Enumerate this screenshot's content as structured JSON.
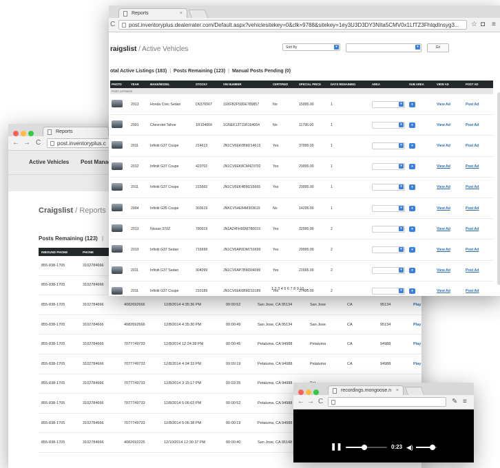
{
  "colors": {
    "accent": "#2a6db0",
    "header_dark": "#23282b",
    "select_blue": "#3b7fe0"
  },
  "reports_window": {
    "tab_title": "Reports",
    "url": "post.inventoryplus.c",
    "nav": [
      "Active Vehicles",
      "Post Manag"
    ],
    "breadcrumb": {
      "site": "Craigslist",
      "sep": "/",
      "page": "Reports"
    },
    "panel_title": "Posts Remaining (123)",
    "panel_sep": "|",
    "columns": [
      "INBOUND PHONE",
      "PHONE",
      "",
      "",
      "",
      "",
      "",
      "",
      ""
    ],
    "rows": [
      [
        "855-838-1705",
        "3102784666",
        "",
        "",
        "",
        "",
        "",
        "",
        ""
      ],
      [
        "855-838-1705",
        "3102784666",
        "",
        "",
        "",
        "",
        "",
        "",
        ""
      ],
      [
        "855-838-1705",
        "3102784666",
        "4082692666",
        "12/8/2014 4:35:36 PM",
        "00:00:52",
        "San Jose, CA 95134",
        "San Jose",
        "CA",
        "95134",
        "Play"
      ],
      [
        "855-838-1705",
        "3102784666",
        "4082692666",
        "12/8/2014 4:35:30 PM",
        "00:00:49",
        "San Jose, CA 95134",
        "San Jose",
        "CA",
        "95134",
        "Play"
      ],
      [
        "855-838-1705",
        "3102784666",
        "7077749733",
        "12/8/2014 12:24:38 PM",
        "00:00:45",
        "Petaluma, CA 94988",
        "Petaluma",
        "CA",
        "94988",
        "Play"
      ],
      [
        "855-838-1705",
        "3102784666",
        "7077749733",
        "12/8/2014 4:34:33 PM",
        "00:00:19",
        "Petaluma, CA 94988",
        "Petaluma",
        "CA",
        "94988",
        "Play"
      ],
      [
        "855-838-1705",
        "3102784666",
        "7077749733",
        "12/8/2014 3:15:17 PM",
        "00:03:35",
        "Petaluma, CA 94988",
        "Pet",
        "",
        "",
        ""
      ],
      [
        "855-838-1705",
        "3102784666",
        "7077749733",
        "12/8/2014 5:06:03 PM",
        "00:00:52",
        "Petaluma, CA 94988",
        "Pet",
        "",
        "",
        ""
      ],
      [
        "855-838-1705",
        "3102784666",
        "7077749733",
        "12/8/2014 5:06:38 PM",
        "00:00:19",
        "Petaluma, CA 94988",
        "Pet",
        "",
        "",
        ""
      ],
      [
        "855-838-1705",
        "3102784666",
        "4082692225",
        "12/10/2014 12:30:37 PM",
        "00:00:40",
        "San Jose, CA 95148",
        "San",
        "",
        "",
        ""
      ]
    ]
  },
  "vehicles_window": {
    "tab_title": "Reports",
    "url": "post.inventoryplus.dealerrater.com/Default.aspx?vehiclesitekey=0&clk=9788&sitekey=1ey3U3D3DY3NIta5CMV0x1LfTZ3FhtqdInsyg3...",
    "breadcrumb": {
      "site": "raigslist",
      "sep": "/",
      "page": "Active Vehicles"
    },
    "sort_label": "Sort By",
    "go_label": "Go",
    "summary": {
      "active": "otal Active Listings (183)",
      "remaining": "Posts Remaining (123)",
      "pending": "Manual Posts Pending (0)",
      "sep": "|"
    },
    "columns": [
      "PHOTO",
      "YEAR",
      "MAKE/MODEL",
      "STOCK#",
      "VIN NUMBER",
      "CERTIFIED",
      "SPECIAL PRICE",
      "DAYS REMAINING",
      "AREA",
      "SUB AREA",
      "VIEW AD",
      "POST AD"
    ],
    "group_label": "POST LISTINGS",
    "rows": [
      {
        "year": "2013",
        "model": "Honda Civic Sedan",
        "stock": "D6376567",
        "vin": "19XFB2F59DE789857",
        "cert": "No",
        "price": "15995.00",
        "days": "1",
        "view": "View Ad",
        "post": "Post Ad",
        "underline": false
      },
      {
        "year": "2001",
        "model": "Chevrolet Tahoe",
        "stock": "1R104664",
        "vin": "1GNEK13T11R164664",
        "cert": "No",
        "price": "11795.00",
        "days": "1",
        "view": "View Ad",
        "post": "Post Ad",
        "underline": false
      },
      {
        "year": "2011",
        "model": "Infiniti G37 Coupe",
        "stock": "214613",
        "vin": "JN1CV6EK0BM214613",
        "cert": "Yes",
        "price": "37995.00",
        "days": "1",
        "view": "View Ad",
        "post": "Post Ad",
        "underline": false
      },
      {
        "year": "2012",
        "model": "Infiniti G37 Coupe",
        "stock": "423702",
        "vin": "JN1CV6EK8CM423702",
        "cert": "Yes",
        "price": "29995.00",
        "days": "1",
        "view": "View Ad",
        "post": "Post Ad",
        "underline": true
      },
      {
        "year": "2011",
        "model": "Infiniti G37 Coupe",
        "stock": "215665",
        "vin": "JN1CV6EK4BM215665",
        "cert": "Yes",
        "price": "29995.00",
        "days": "1",
        "view": "View Ad",
        "post": "Post Ad",
        "underline": true
      },
      {
        "year": "2004",
        "model": "Infiniti G35 Coupe",
        "stock": "303619",
        "vin": "JNKCV54E84M303619",
        "cert": "No",
        "price": "14295.00",
        "days": "1",
        "view": "View Ad",
        "post": "Post Ad",
        "underline": true
      },
      {
        "year": "2013",
        "model": "Nissan 370Z",
        "stock": "780019",
        "vin": "JN1AZ4FH9DM780019",
        "cert": "Yes",
        "price": "32995.00",
        "days": "2",
        "view": "View Ad",
        "post": "Post Ad",
        "underline": true
      },
      {
        "year": "2013",
        "model": "Infiniti G37 Sedan",
        "stock": "716699",
        "vin": "JN1CV6AP0DM716699",
        "cert": "Yes",
        "price": "29995.00",
        "days": "2",
        "view": "View Ad",
        "post": "Post Ad",
        "underline": true
      },
      {
        "year": "2011",
        "model": "Infiniti G37 Sedan",
        "stock": "304099",
        "vin": "JN1CV6AP7BM304099",
        "cert": "Yes",
        "price": "22995.00",
        "days": "2",
        "view": "View Ad",
        "post": "Post Ad",
        "underline": true
      },
      {
        "year": "2011",
        "model": "Infiniti G37 Coupe",
        "stock": "210189",
        "vin": "JN1CV6EK6BM210189",
        "cert": "Yes",
        "price": "27495.00",
        "days": "2",
        "view": "View Ad",
        "post": "Post Ad",
        "underline": true
      }
    ],
    "pager": "1 2 3 4 5 6 7 8 9 10 ..."
  },
  "video_window": {
    "tab_title": "recordings.mongoose.n",
    "url": "",
    "time": "0:23",
    "progress_fraction": 0.45,
    "volume_fraction": 0.8
  }
}
